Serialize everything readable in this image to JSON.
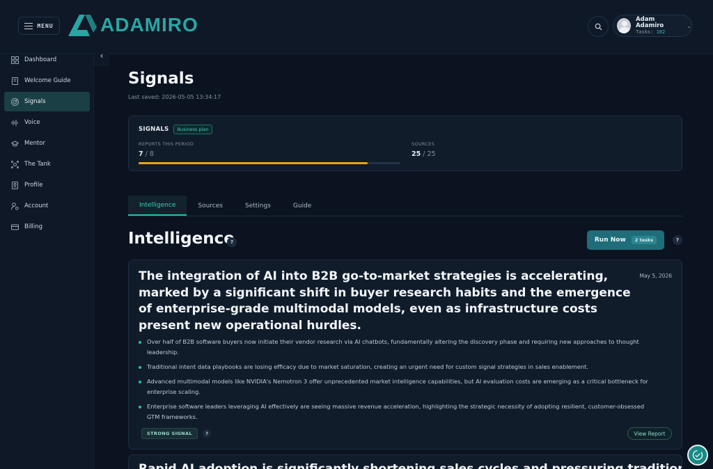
{
  "header": {
    "menu_label": "MENU",
    "logo_text": "ADAMIRO",
    "user_name": "Adam Adamiro",
    "tasks_label": "Tasks:",
    "tasks_count": "102"
  },
  "sidebar": {
    "items": [
      {
        "label": "Dashboard",
        "icon": "dashboard-icon"
      },
      {
        "label": "Welcome Guide",
        "icon": "book-icon"
      },
      {
        "label": "Signals",
        "icon": "radar-icon",
        "active": true
      },
      {
        "label": "Voice",
        "icon": "waveform-icon"
      },
      {
        "label": "Mentor",
        "icon": "graduation-cap-icon"
      },
      {
        "label": "The Tank",
        "icon": "network-icon"
      },
      {
        "label": "Profile",
        "icon": "profile-card-icon"
      },
      {
        "label": "Account",
        "icon": "user-gear-icon"
      },
      {
        "label": "Billing",
        "icon": "credit-card-icon"
      }
    ]
  },
  "page": {
    "title": "Signals",
    "last_saved": "Last saved: 2026-05-05 13:34:17"
  },
  "plan_card": {
    "label": "SIGNALS",
    "badge": "Business plan",
    "reports_label": "REPORTS THIS PERIOD",
    "reports_used": "7",
    "reports_total": " / 8",
    "reports_progress": 0.875,
    "sources_label": "SOURCES",
    "sources_used": "25",
    "sources_total": " / 25",
    "progress_color": "#f0a11b"
  },
  "tabs": [
    "Intelligence",
    "Sources",
    "Settings",
    "Guide"
  ],
  "intelligence": {
    "title": "Intelligence",
    "help": "?",
    "run_label": "Run Now",
    "run_pill": "2 tasks"
  },
  "article": {
    "title": "The integration of AI into B2B go-to-market strategies is accelerating, marked by a significant shift in buyer research habits and the emergence of enterprise-grade multimodal models, even as infrastructure costs present new operational hurdles.",
    "date": "May 5, 2026",
    "bullets": [
      "Over half of B2B software buyers now initiate their vendor research via AI chatbots, fundamentally altering the discovery phase and requiring new approaches to thought leadership.",
      "Traditional intent data playbooks are losing efficacy due to market saturation, creating an urgent need for custom signal strategies in sales enablement.",
      "Advanced multimodal models like NVIDIA's Nemotron 3 offer unprecedented market intelligence capabilities, but AI evaluation costs are emerging as a critical bottleneck for enterprise scaling.",
      "Enterprise software leaders leveraging AI effectively are seeing massive revenue acceleration, highlighting the strategic necessity of adopting resilient, customer-obsessed GTM frameworks."
    ],
    "signal_label": "STRONG SIGNAL",
    "view_label": "View Report"
  },
  "article2": {
    "title": "Rapid AI adoption is significantly shortening sales cycles and pressuring traditional intent"
  },
  "colors": {
    "accent": "#2fbba8",
    "brand": "#2aa6a3",
    "background": "#0b1320"
  }
}
